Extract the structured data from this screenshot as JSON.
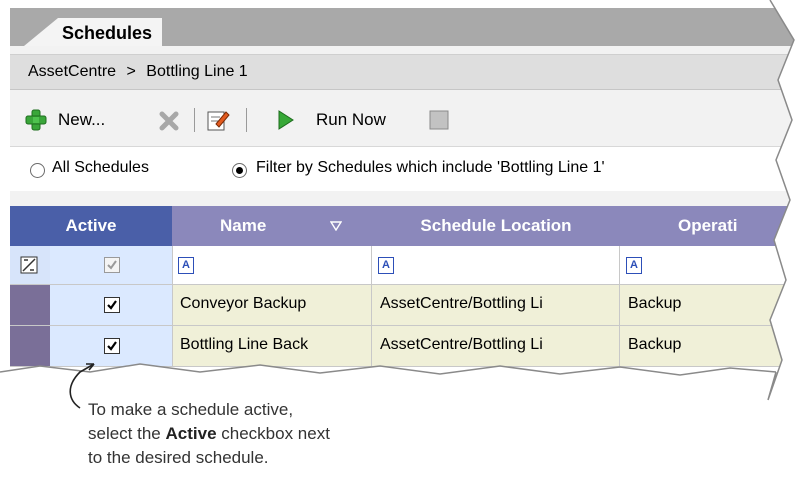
{
  "tab": {
    "label": "Schedules"
  },
  "breadcrumb": {
    "root": "AssetCentre",
    "separator": ">",
    "current": "Bottling Line 1"
  },
  "toolbar": {
    "new_label": "New...",
    "run_now_label": "Run Now"
  },
  "filter": {
    "all_label": "All Schedules",
    "filtered_label": "Filter by Schedules which include 'Bottling Line 1'",
    "selected": "filtered"
  },
  "grid": {
    "columns": [
      "Active",
      "Name",
      "Schedule Location",
      "Operati"
    ],
    "filter_icon": "A",
    "rows": [
      {
        "active": true,
        "name": "Conveyor Backup",
        "location": "AssetCentre/Bottling Li",
        "operation": "Backup"
      },
      {
        "active": true,
        "name": "Bottling Line Back",
        "location": "AssetCentre/Bottling Li",
        "operation": "Backup"
      }
    ]
  },
  "callout": {
    "line1": "To make a schedule active,",
    "line2_prefix": "select the ",
    "line2_bold": "Active",
    "line2_suffix": " checkbox next",
    "line3": "to the desired schedule."
  },
  "colors": {
    "header_active": "#4a5fa8",
    "header": "#8b88bb",
    "row_bg": "#f0f0d8",
    "active_col": "#dbe9ff"
  }
}
